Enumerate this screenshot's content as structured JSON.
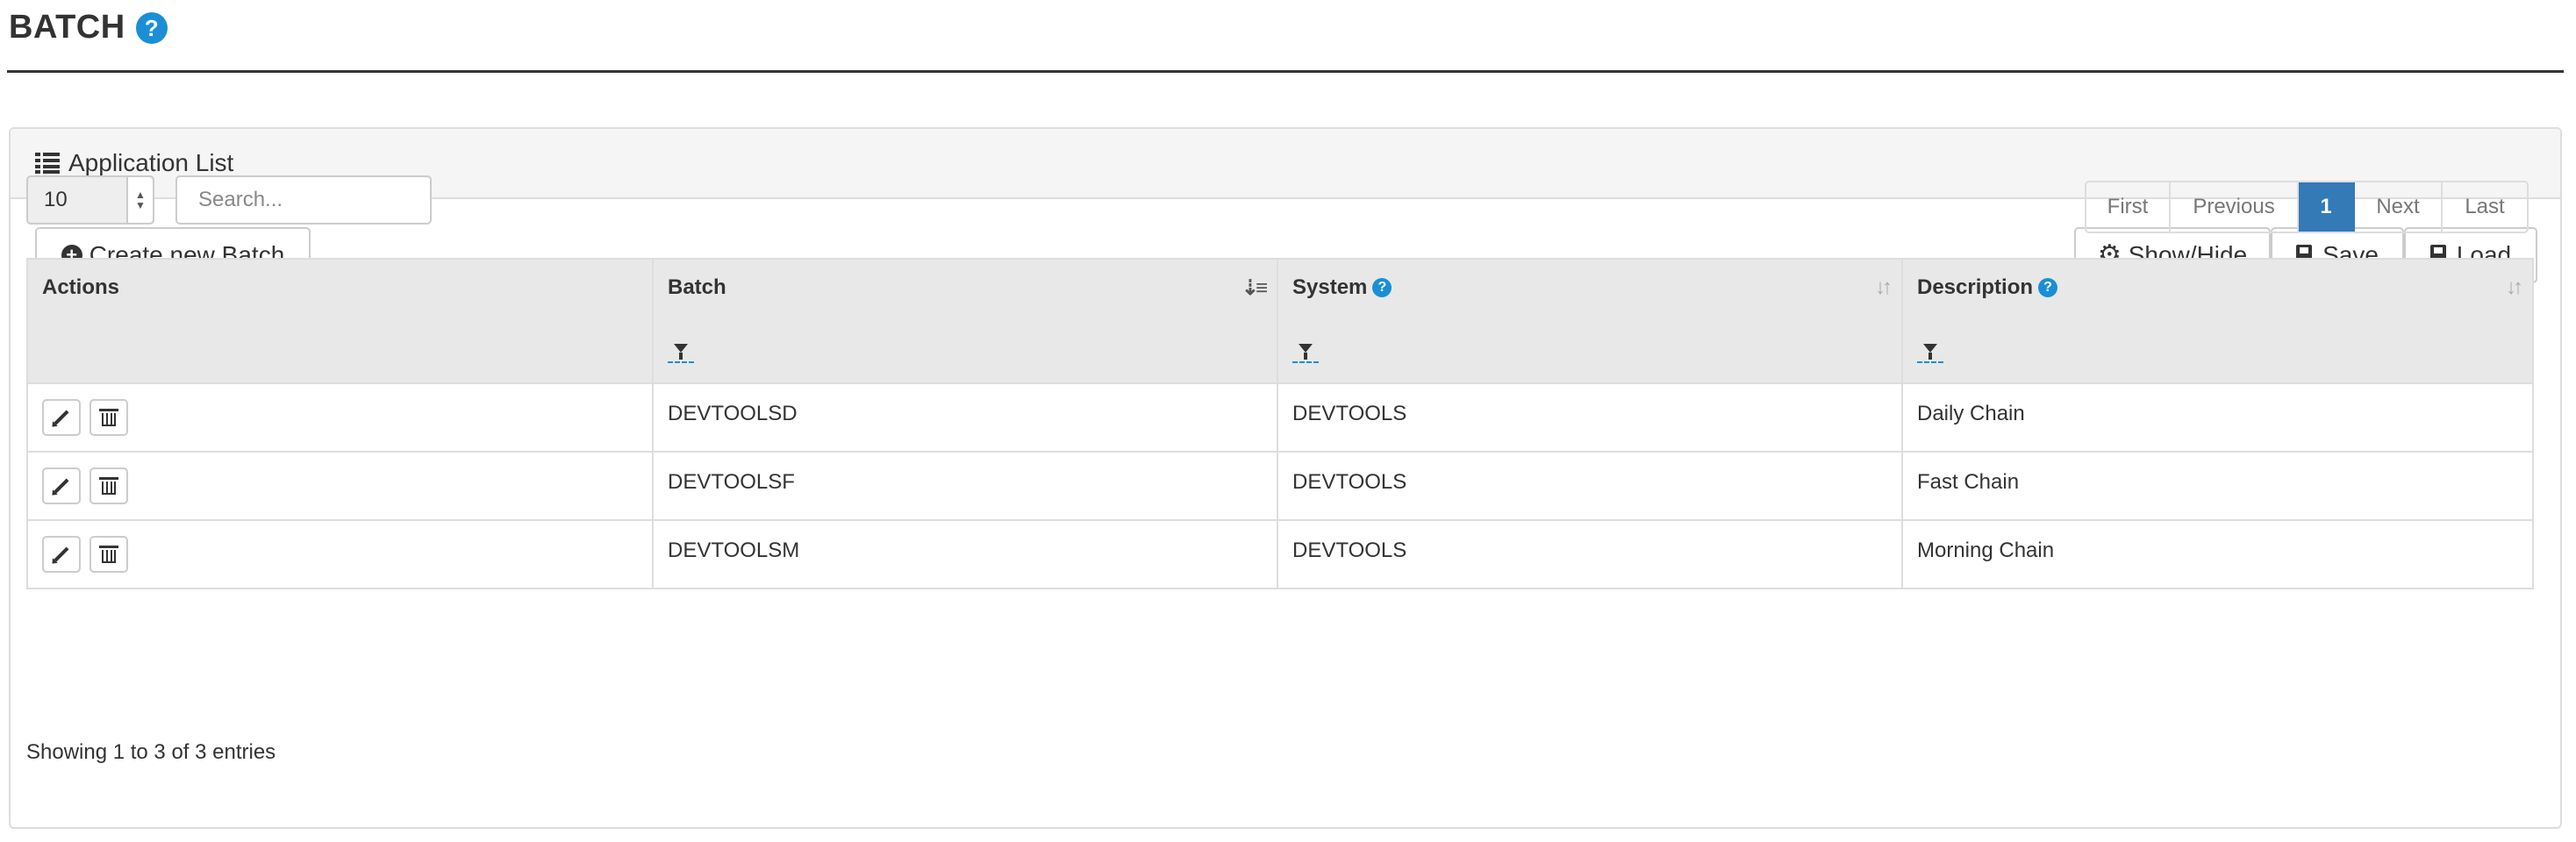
{
  "page": {
    "title": "BATCH",
    "help_glyph": "?"
  },
  "panel": {
    "title": "Application List"
  },
  "toolbar": {
    "create_label": "Create new Batch",
    "show_hide_label": "Show/Hide",
    "save_label": "Save",
    "load_label": "Load"
  },
  "length": {
    "value": "10"
  },
  "search": {
    "placeholder": "Search..."
  },
  "pagination": {
    "first": "First",
    "previous": "Previous",
    "current": "1",
    "next": "Next",
    "last": "Last"
  },
  "table": {
    "columns": [
      {
        "label": "Actions"
      },
      {
        "label": "Batch"
      },
      {
        "label": "System"
      },
      {
        "label": "Description"
      }
    ],
    "rows": [
      {
        "batch": "DEVTOOLSD",
        "system": "DEVTOOLS",
        "description": "Daily Chain"
      },
      {
        "batch": "DEVTOOLSF",
        "system": "DEVTOOLS",
        "description": "Fast Chain"
      },
      {
        "batch": "DEVTOOLSM",
        "system": "DEVTOOLS",
        "description": "Morning Chain"
      }
    ]
  },
  "info": "Showing 1 to 3 of 3 entries",
  "colors": {
    "accent": "#337ab7",
    "help": "#1a8fd6",
    "header_bg": "#e8e8e8"
  }
}
